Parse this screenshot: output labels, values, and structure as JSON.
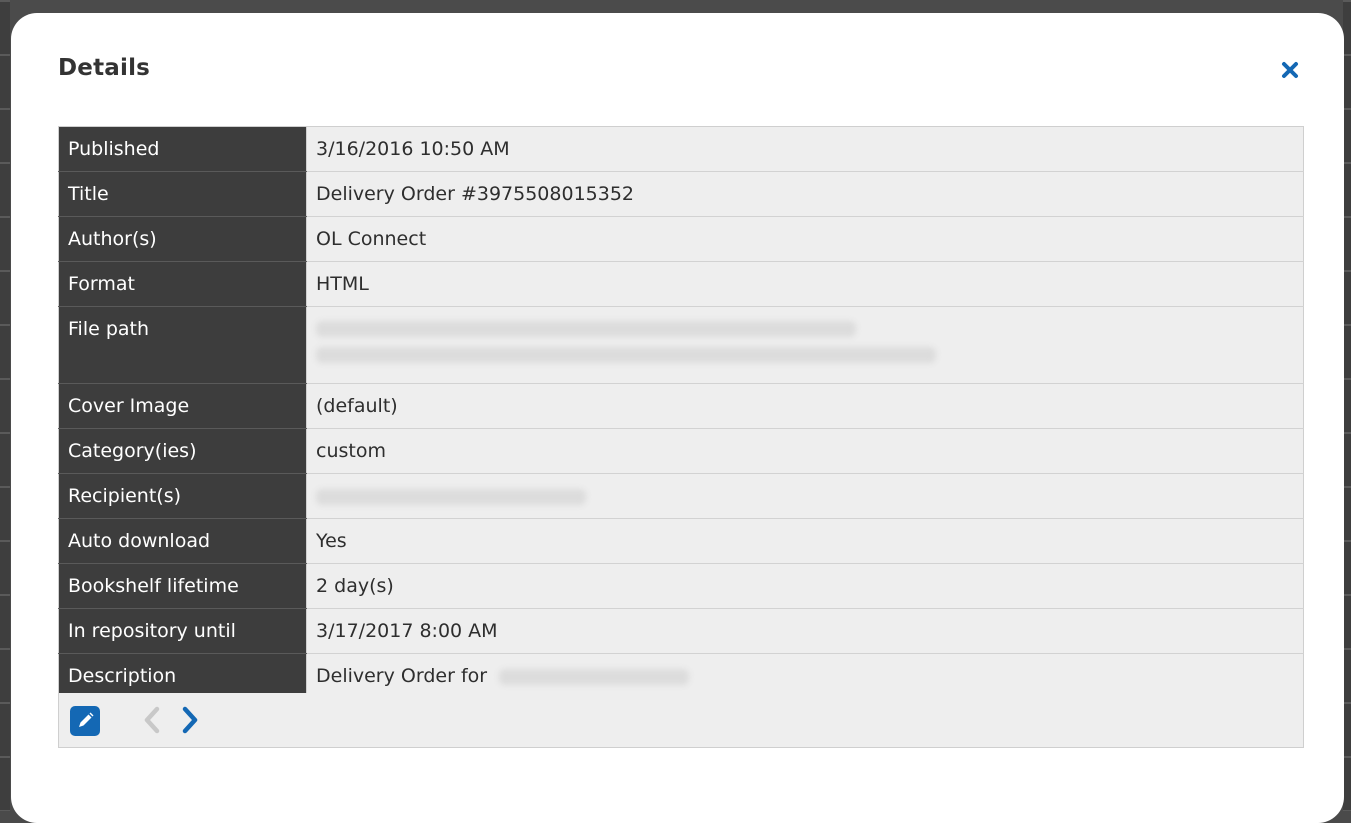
{
  "dialog": {
    "title": "Details"
  },
  "details": [
    {
      "label": "Published",
      "value": "3/16/2016 10:50 AM"
    },
    {
      "label": "Title",
      "value": "Delivery Order #3975508015352"
    },
    {
      "label": "Author(s)",
      "value": "OL Connect"
    },
    {
      "label": "Format",
      "value": "HTML"
    },
    {
      "label": "File path",
      "value": ""
    },
    {
      "label": "Cover Image",
      "value": "(default)"
    },
    {
      "label": "Category(ies)",
      "value": "custom"
    },
    {
      "label": "Recipient(s)",
      "value": ""
    },
    {
      "label": "Auto download",
      "value": "Yes"
    },
    {
      "label": "Bookshelf lifetime",
      "value": "2 day(s)"
    },
    {
      "label": "In repository until",
      "value": "3/17/2017 8:00 AM"
    },
    {
      "label": "Description",
      "value": "Delivery Order for"
    }
  ],
  "icons": {
    "close": "close-icon",
    "edit": "edit-icon",
    "previous": "chevron-left-icon",
    "next": "chevron-right-icon"
  },
  "colors": {
    "accent": "#1468b4",
    "label_bg": "#3d3d3d",
    "value_bg": "#eeeeee",
    "disabled": "#c8c8c8"
  }
}
